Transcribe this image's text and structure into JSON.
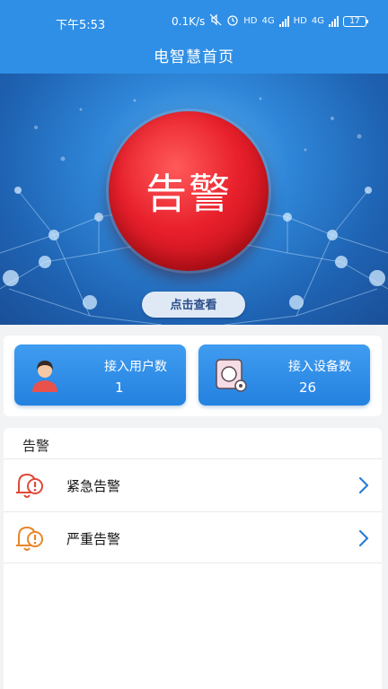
{
  "status_bar": {
    "time": "下午5:53",
    "network_speed": "0.1K/s",
    "hd_badge_1": "HD",
    "lte_1": "4G",
    "hd_badge_2": "HD",
    "lte_2": "4G",
    "battery": "17"
  },
  "header": {
    "title": "电智慧首页"
  },
  "banner": {
    "alarm_text": "告警",
    "view_button": "点击查看"
  },
  "stats": {
    "users": {
      "label": "接入用户数",
      "value": "1"
    },
    "devices": {
      "label": "接入设备数",
      "value": "26"
    }
  },
  "alarm_section": {
    "title": "告警",
    "items": [
      {
        "label": "紧急告警",
        "icon": "bell-alert-icon",
        "color": "#e04a3a"
      },
      {
        "label": "严重告警",
        "icon": "bell-alert-icon",
        "color": "#e8862a"
      }
    ]
  },
  "colors": {
    "primary": "#2f8fe6",
    "alarm_red": "#e8202c",
    "chevron": "#2a7fd4"
  }
}
